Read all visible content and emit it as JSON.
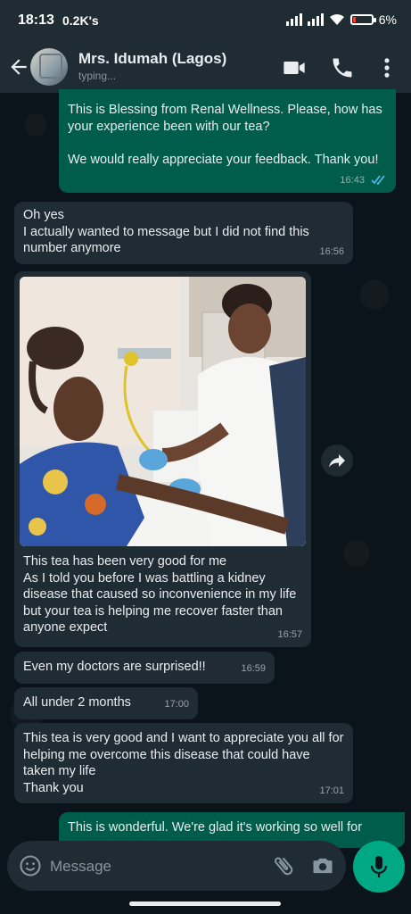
{
  "status_bar": {
    "time": "18:13",
    "network_speed": "0.2K's",
    "battery": "6%",
    "battery_color": "#ff3b30"
  },
  "header": {
    "contact_name": "Mrs. Idumah (Lagos)",
    "status": "typing..."
  },
  "messages": [
    {
      "direction": "out",
      "text": "This is Blessing from Renal Wellness. Please, how has your experience been with our tea?\n\nWe would really appreciate your feedback. Thank you!",
      "time": "16:43",
      "read": true
    },
    {
      "direction": "in",
      "text": " Oh yes\nI actually wanted to message but I did not find this number anymore",
      "time": "16:56"
    },
    {
      "direction": "in",
      "image": "patient-at-clinic-photo",
      "text": "This tea has been very good for me\nAs I told you before I was battling a kidney disease that caused so inconvenience in my life but your tea is helping me recover faster than anyone expect",
      "time": "16:57"
    },
    {
      "direction": "in",
      "text": "Even my doctors are surprised!!",
      "time": "16:59"
    },
    {
      "direction": "in",
      "text": "All under 2 months",
      "time": "17:00"
    },
    {
      "direction": "in",
      "text": "This tea is very good and I want to appreciate you all for helping me overcome this disease that could have taken my life\nThank you",
      "time": "17:01"
    },
    {
      "direction": "out",
      "text": "This is wonderful. We're glad it's working so well for"
    }
  ],
  "composer": {
    "placeholder": "Message"
  },
  "colors": {
    "incoming": "#1f2c34",
    "outgoing": "#005c4b",
    "accent": "#00a884",
    "read_ticks": "#53bdeb"
  }
}
